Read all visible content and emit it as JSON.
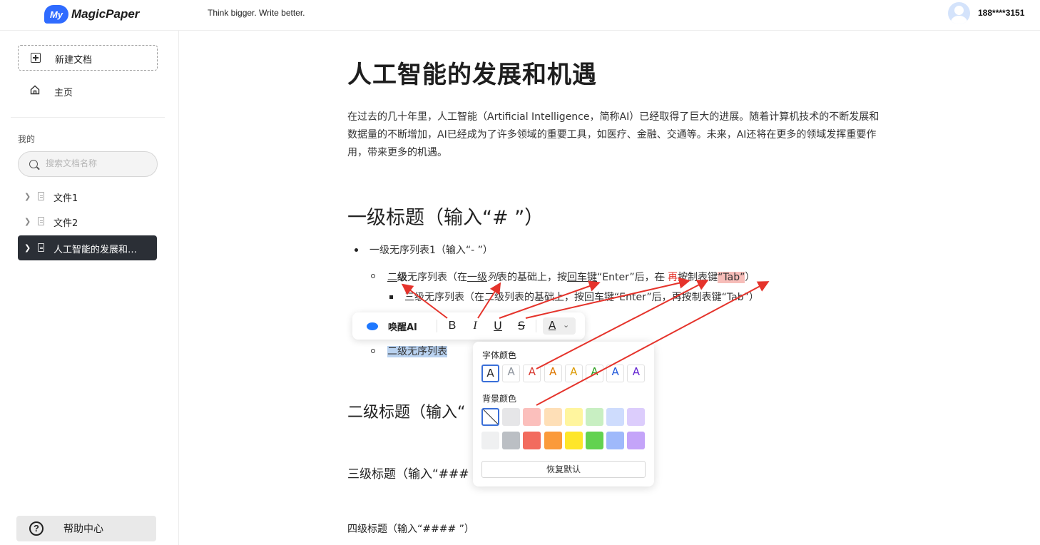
{
  "header": {
    "logo_badge": "My",
    "logo_text": "MagicPaper",
    "slogan": "Think bigger. Write better.",
    "user": "188****3151"
  },
  "sidebar": {
    "new_doc": "新建文档",
    "home": "主页",
    "section_label": "我的",
    "search_placeholder": "搜索文档名称",
    "docs": [
      {
        "label": "文件1",
        "active": false
      },
      {
        "label": "文件2",
        "active": false
      },
      {
        "label": "人工智能的发展和…",
        "active": true
      }
    ],
    "help": "帮助中心"
  },
  "doc": {
    "title": "人工智能的发展和机遇",
    "paragraph": "在过去的几十年里，人工智能（Artificial Intelligence，简称AI）已经取得了巨大的进展。随着计算机技术的不断发展和数据量的不断增加，AI已经成为了许多领域的重要工具，如医疗、金融、交通等。未来，AI还将在更多的领域发挥重要作用，带来更多的机遇。",
    "h1": "一级标题（输入“# ”）",
    "list1": "一级无序列表1（输入“- ”）",
    "list2_parts": {
      "a": "二",
      "b": "级",
      "c": "无序列表（在",
      "d": "一级",
      "e": "列",
      "f": "表的基础上，按",
      "g": "回车键",
      "h": "“Enter”后，",
      "i": "在",
      "j": " ",
      "k": "再",
      "l": "按制表键",
      "m": "“Tab”",
      "n": "）"
    },
    "list3": "三级无序列表（在二级列表的基础上，按回车键“Enter”后，再按制表键“Tab”）",
    "list2b": "二级无序列表",
    "h2": "二级标题（输入“",
    "h3": "三级标题（输入“### ”",
    "h4": "四级标题（输入“#### ”）"
  },
  "toolbar": {
    "ai_label": "唤醒AI",
    "bold": "B",
    "italic": "I",
    "underline": "U",
    "strike": "S",
    "color_btn": "A",
    "chevron": "⌄"
  },
  "palette": {
    "font_color_label": "字体颜色",
    "bg_color_label": "背景颜色",
    "reset": "恢复默认",
    "swatch_letter": "A",
    "font_colors": [
      "#222222",
      "#8f959e",
      "#d83931",
      "#de7802",
      "#dc9b04",
      "#2ea121",
      "#245bdb",
      "#6425d0"
    ],
    "bg_colors_row1": [
      "none",
      "#e6e6e8",
      "#fbbfbc",
      "#fedfb7",
      "#fff59e",
      "#c8efc2",
      "#cedcfd",
      "#dccdfc"
    ],
    "bg_colors_row2": [
      "#eff0f1",
      "#bbbfc4",
      "#f26b5e",
      "#fb9a3a",
      "#fee62a",
      "#62d250",
      "#9fb9fb",
      "#c4a4f9"
    ]
  },
  "annotation_color": "#e5332b"
}
